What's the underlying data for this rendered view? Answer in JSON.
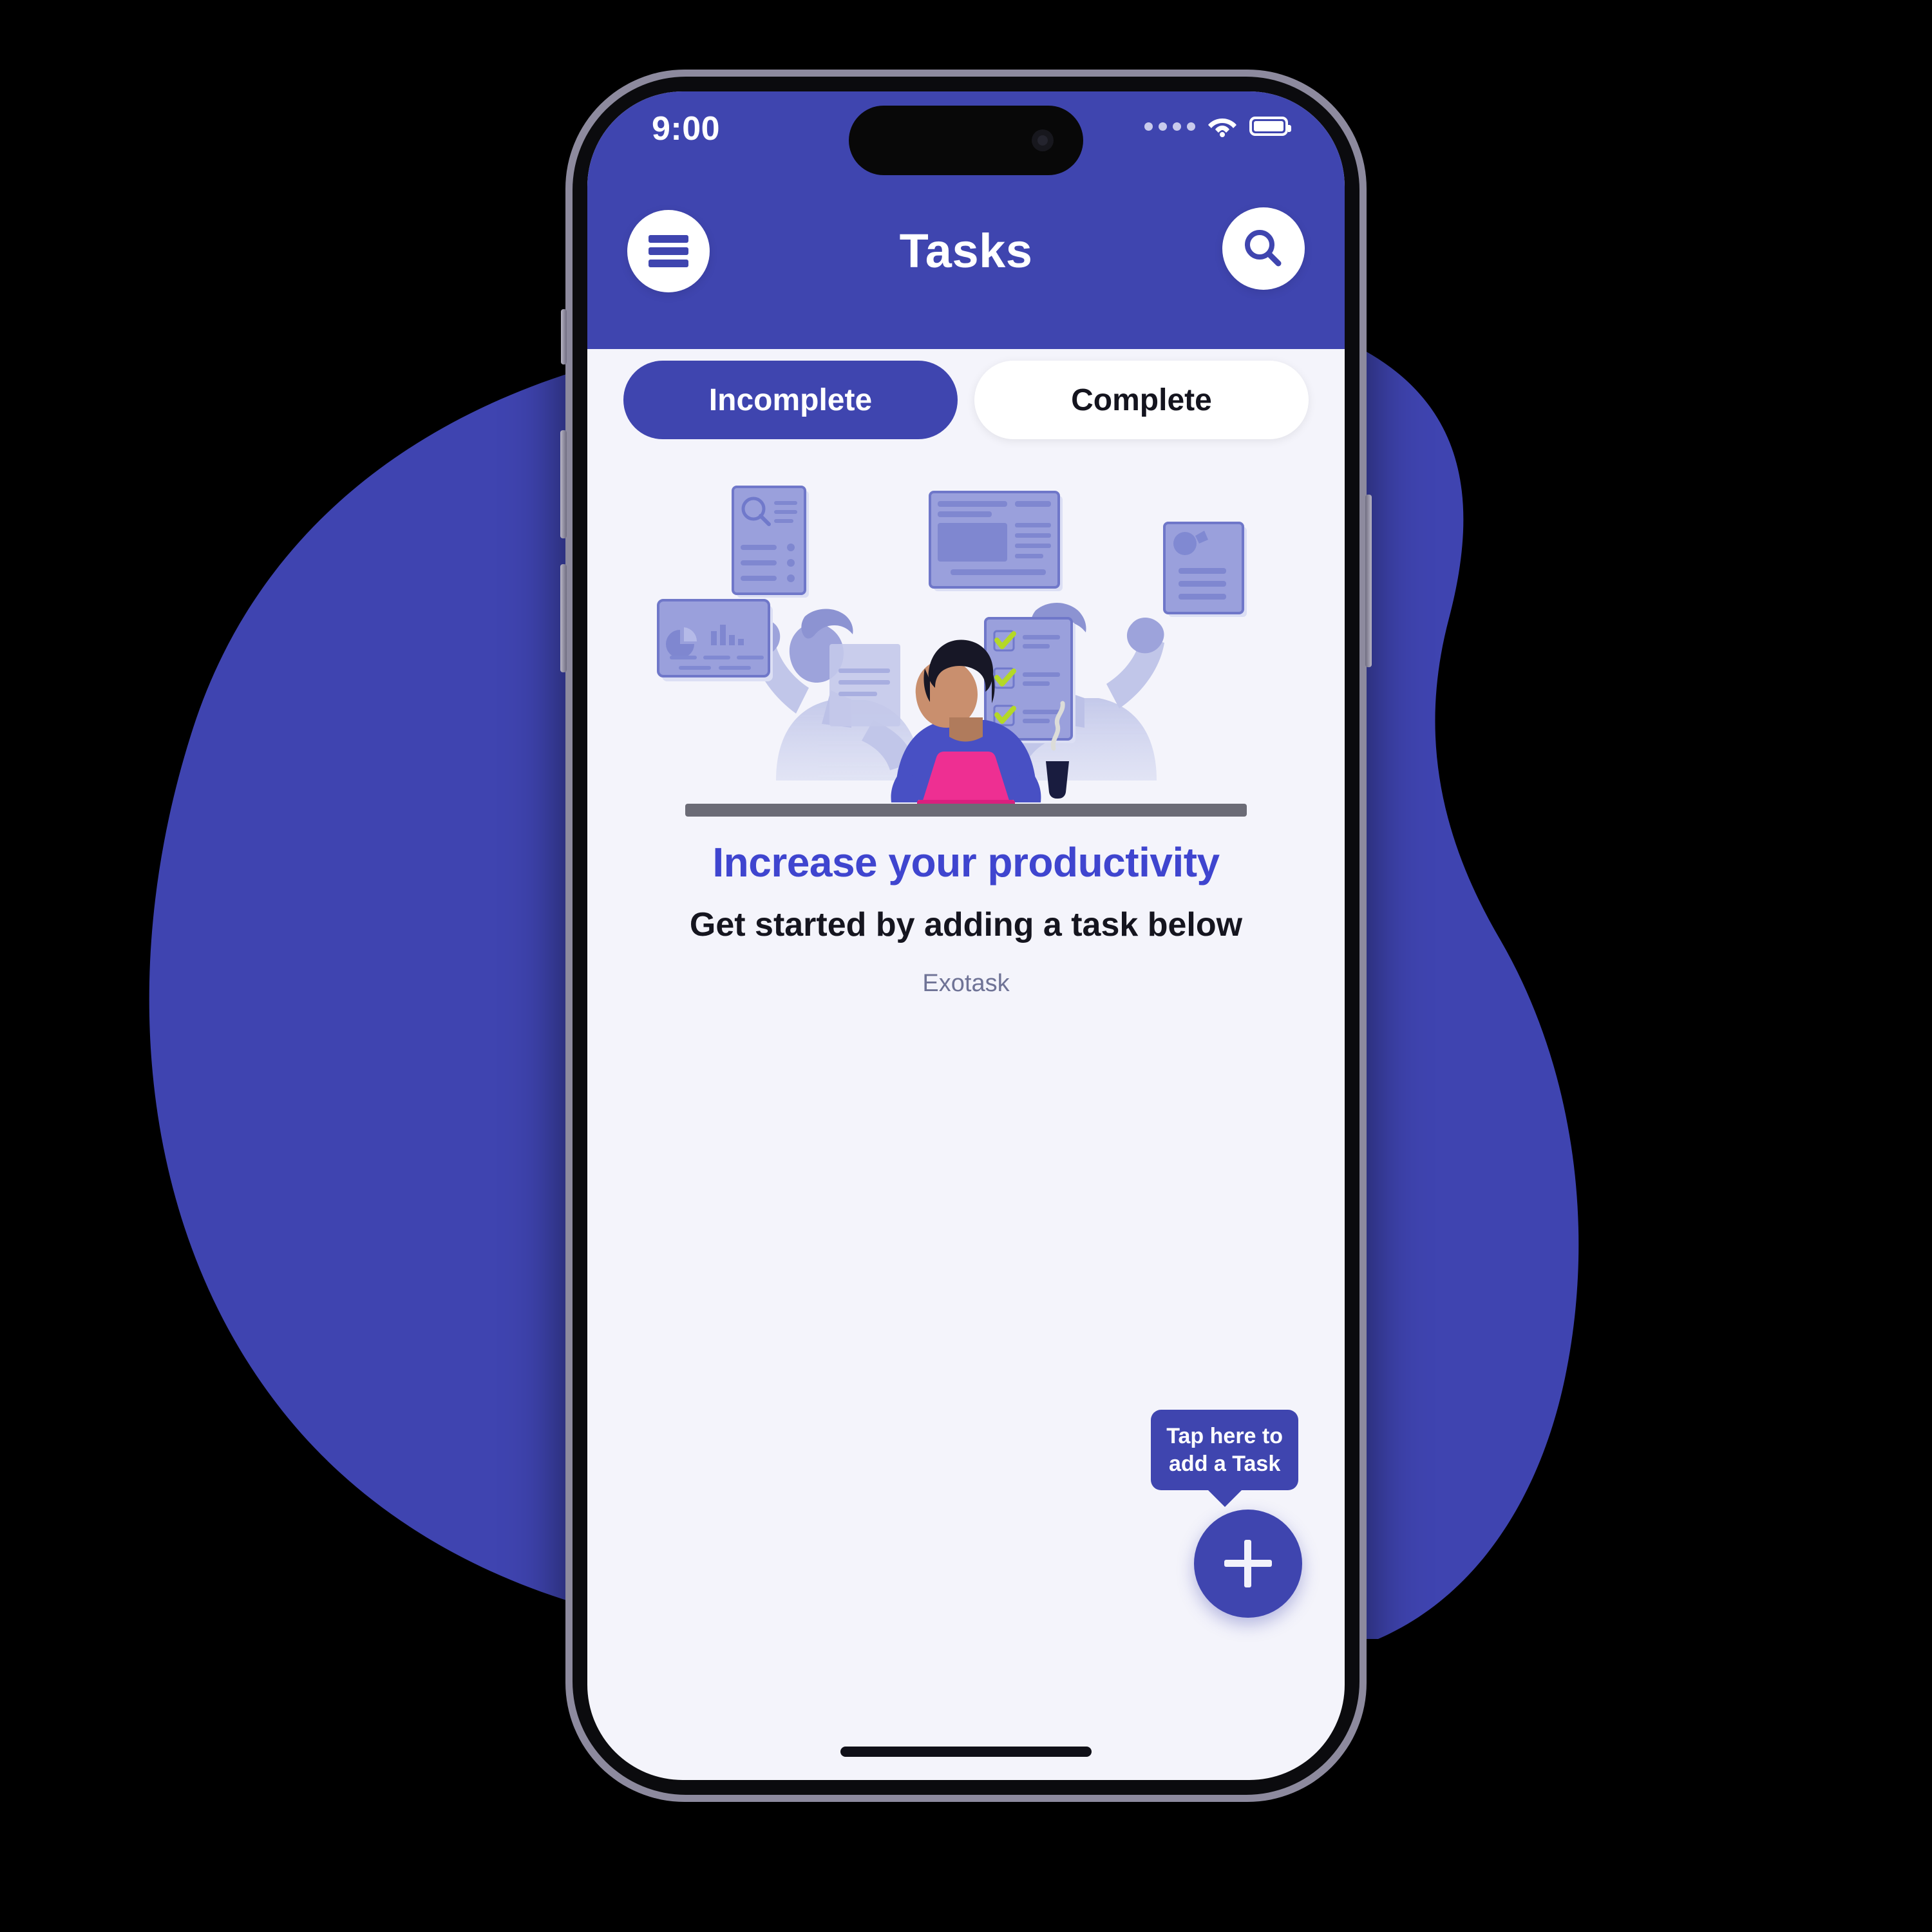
{
  "theme": {
    "primary": "#3f45af",
    "blob": "#3f44b0",
    "screen_bg": "#f4f4fb",
    "headline_color": "#3f45cf",
    "accent_pink": "#ee2f92",
    "check_green": "#b4d827",
    "card_lavender": "#9aa0dc",
    "ghost_lavender": "#b9bfe6"
  },
  "status_bar": {
    "time": "9:00",
    "cellular_icon": "cellular-dots-icon",
    "wifi_icon": "wifi-icon",
    "battery_icon": "battery-full-icon"
  },
  "nav": {
    "menu_icon": "hamburger-menu-icon",
    "title": "Tasks",
    "search_icon": "search-icon"
  },
  "tabs": [
    {
      "label": "Incomplete",
      "active": true
    },
    {
      "label": "Complete",
      "active": false
    }
  ],
  "empty_state": {
    "illustration_name": "multitasking-productivity-illustration",
    "headline": "Increase your productivity",
    "subhead": "Get started by adding a task below",
    "brand": "Exotask"
  },
  "fab": {
    "icon": "plus-icon",
    "tooltip": "Tap here to\nadd a Task"
  },
  "home_indicator": "home-indicator-bar"
}
